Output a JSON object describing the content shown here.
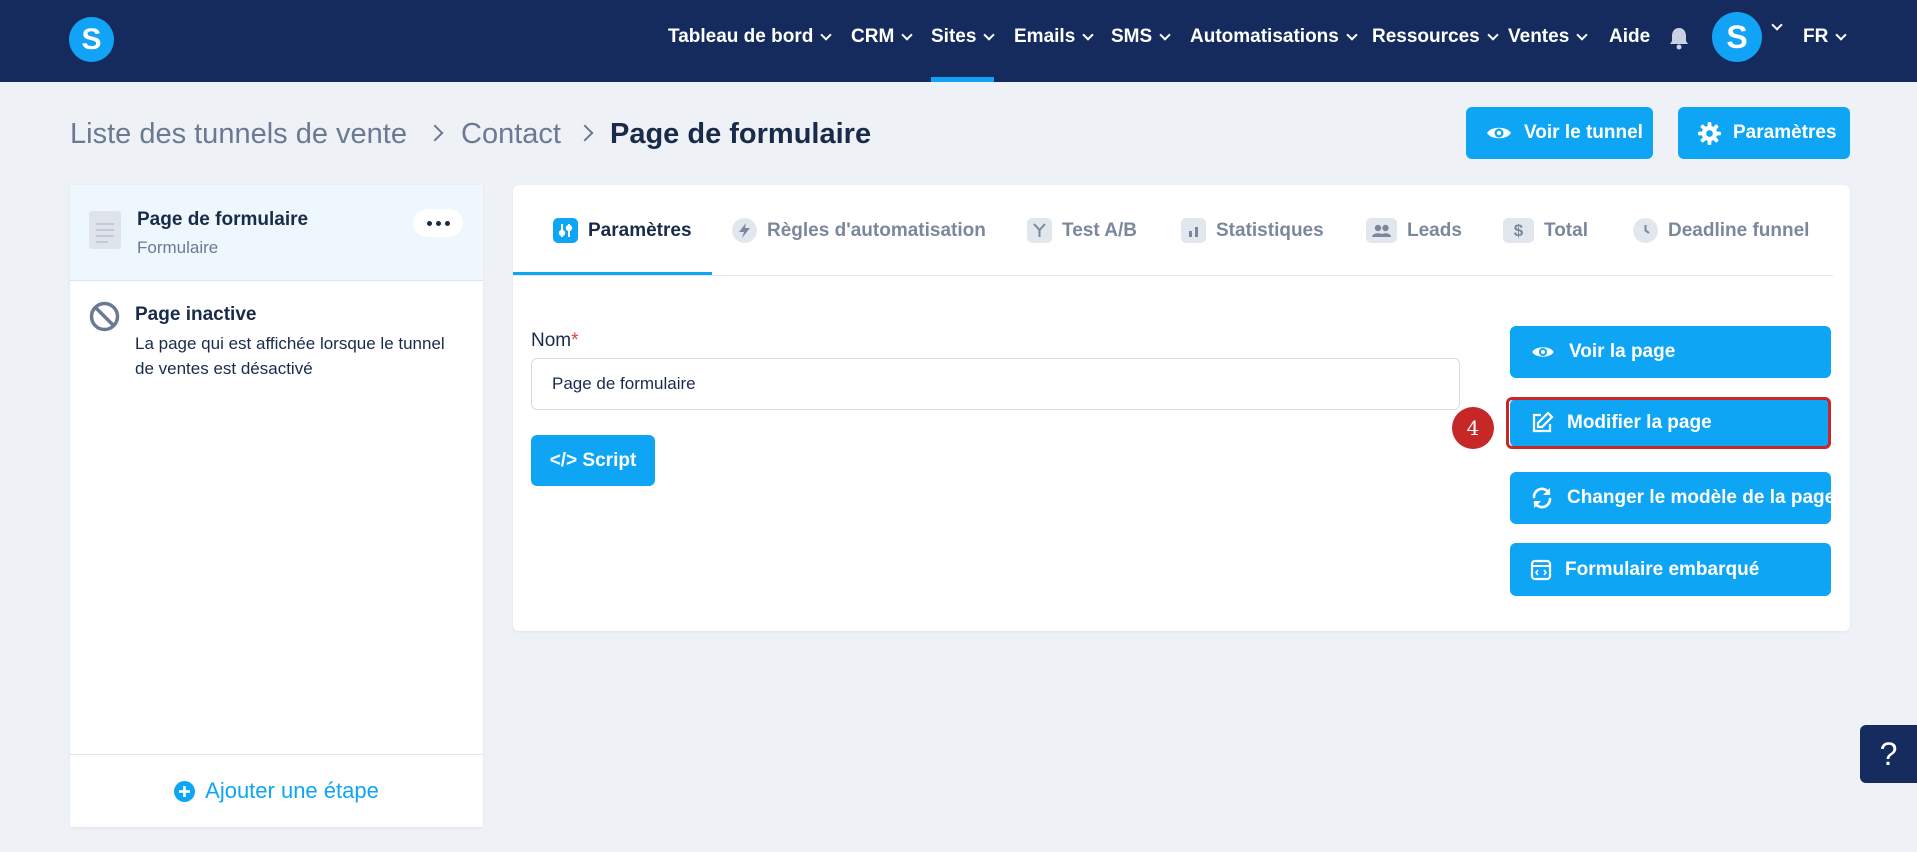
{
  "nav": {
    "logo": "S",
    "items": [
      {
        "label": "Tableau de bord",
        "has_chevron": true
      },
      {
        "label": "CRM",
        "has_chevron": true
      },
      {
        "label": "Sites",
        "has_chevron": true,
        "active": true
      },
      {
        "label": "Emails",
        "has_chevron": true
      },
      {
        "label": "SMS",
        "has_chevron": true
      },
      {
        "label": "Automatisations",
        "has_chevron": true
      },
      {
        "label": "Ressources",
        "has_chevron": true
      },
      {
        "label": "Ventes",
        "has_chevron": true
      },
      {
        "label": "Aide",
        "has_chevron": false
      }
    ],
    "avatar": "S",
    "language": "FR"
  },
  "breadcrumb": {
    "items": [
      "Liste des tunnels de vente",
      "Contact"
    ],
    "current": "Page de formulaire"
  },
  "header_actions": {
    "view_funnel": "Voir le tunnel",
    "settings": "Paramètres"
  },
  "sidebar": {
    "pages": [
      {
        "title": "Page de formulaire",
        "subtitle": "Formulaire",
        "active": true
      }
    ],
    "inactive_page": {
      "title": "Page inactive",
      "description": "La page qui est affichée lorsque le tunnel de ventes est désactivé"
    },
    "add_step": "Ajouter une étape"
  },
  "tabs": [
    {
      "label": "Paramètres",
      "icon": "sliders-icon",
      "active": true
    },
    {
      "label": "Règles d'automatisation",
      "icon": "bolt-icon"
    },
    {
      "label": "Test A/B",
      "icon": "split-icon"
    },
    {
      "label": "Statistiques",
      "icon": "bar-chart-icon"
    },
    {
      "label": "Leads",
      "icon": "users-icon"
    },
    {
      "label": "Total",
      "icon": "dollar-icon"
    },
    {
      "label": "Deadline funnel",
      "icon": "clock-icon"
    }
  ],
  "form": {
    "name_label": "Nom",
    "required_mark": "*",
    "name_value": "Page de formulaire",
    "script_button": "</> Script"
  },
  "page_actions": {
    "view_page": "Voir la page",
    "edit_page": "Modifier la page",
    "change_template": "Changer le modèle de la page",
    "embedded_form": "Formulaire embarqué"
  },
  "annotation": {
    "step_number": "4"
  },
  "help": {
    "label": "?"
  },
  "colors": {
    "nav_bg": "#152b5e",
    "accent": "#0ea5f5",
    "highlight": "#c62828",
    "page_bg": "#eef2f7"
  }
}
